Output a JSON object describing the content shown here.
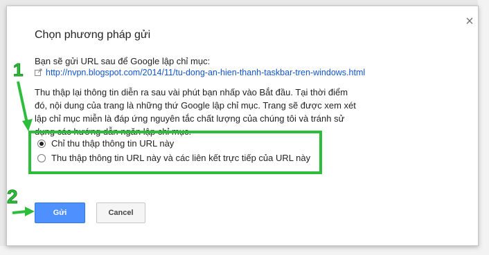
{
  "dialog": {
    "title": "Chọn phương pháp gửi",
    "intro": "Bạn sẽ gửi URL sau để Google lập chỉ mục:",
    "url": "http://nvpn.blogspot.com/2014/11/tu-dong-an-hien-thanh-taskbar-tren-windows.html",
    "description": "Thu thập lại thông tin diễn ra sau vài phút bạn nhấp vào Bắt đầu. Tại thời điểm đó, nội dung của trang là những thứ Google lập chỉ mục. Trang sẽ được xem xét lập chỉ mục miễn là đáp ứng nguyên tắc chất lượng của chúng tôi và tránh sử dụng các hướng dẫn ngăn lập chỉ mục.",
    "options": [
      {
        "label": "Chỉ thu thập thông tin URL này",
        "checked": true
      },
      {
        "label": "Thu thập thông tin URL này và các liên kết trực tiếp của URL này",
        "checked": false
      }
    ],
    "send_label": "Gửi",
    "cancel_label": "Cancel",
    "close_symbol": "×"
  },
  "annotations": {
    "step1": "1",
    "step2": "2",
    "highlight_color": "#2ebd3b"
  },
  "icons": {
    "external_link": "external-link-icon",
    "close": "close-icon"
  }
}
